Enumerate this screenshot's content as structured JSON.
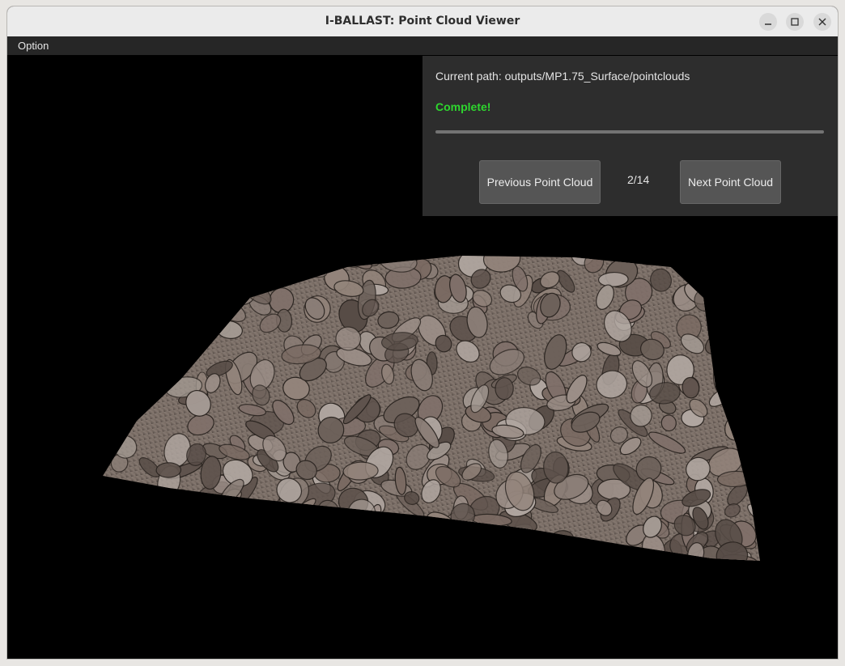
{
  "window": {
    "title": "I-BALLAST: Point Cloud Viewer",
    "controls": [
      "minimize-icon",
      "maximize-icon",
      "close-icon"
    ]
  },
  "menubar": {
    "items": [
      {
        "label": "Option"
      }
    ]
  },
  "panel": {
    "path_text": "Current path: outputs/MP1.75_Surface/pointclouds",
    "status_text": "Complete!",
    "status_color": "#2ed62e",
    "progress": 1.0,
    "prev_label": "Previous Point Cloud",
    "counter": "2/14",
    "next_label": "Next Point Cloud"
  },
  "viewport": {
    "background": "#000000",
    "content": "ballast-point-cloud-render"
  }
}
